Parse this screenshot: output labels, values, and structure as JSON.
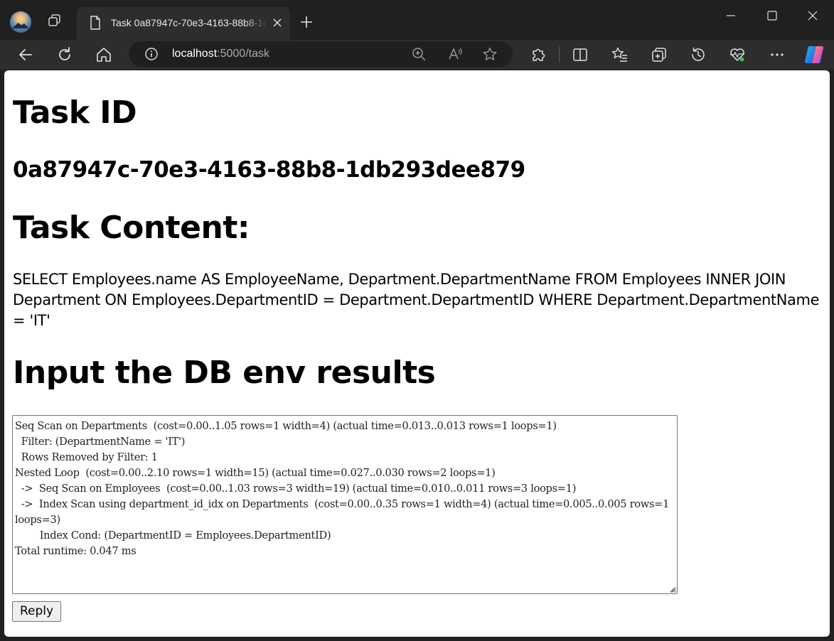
{
  "browser": {
    "tab": {
      "title": "Task 0a87947c-70e3-4163-88b8-1db293dee879"
    },
    "address": {
      "host": "localhost",
      "path": ":5000/task"
    }
  },
  "page": {
    "task_id_heading": "Task ID",
    "task_id_value": "0a87947c-70e3-4163-88b8-1db293dee879",
    "task_content_heading": "Task Content:",
    "task_content_text": "SELECT Employees.name AS EmployeeName, Department.DepartmentName FROM Employees INNER JOIN Department ON Employees.DepartmentID = Department.DepartmentID WHERE Department.DepartmentName = 'IT'",
    "input_heading": "Input the DB env results",
    "results_text": "Seq Scan on Departments  (cost=0.00..1.05 rows=1 width=4) (actual time=0.013..0.013 rows=1 loops=1)\n  Filter: (DepartmentName = 'IT')\n  Rows Removed by Filter: 1\nNested Loop  (cost=0.00..2.10 rows=1 width=15) (actual time=0.027..0.030 rows=2 loops=1)\n  ->  Seq Scan on Employees  (cost=0.00..1.03 rows=3 width=19) (actual time=0.010..0.011 rows=3 loops=1)\n  ->  Index Scan using department_id_idx on Departments  (cost=0.00..0.35 rows=1 width=4) (actual time=0.005..0.005 rows=1 loops=3)\n        Index Cond: (DepartmentID = Employees.DepartmentID)\nTotal runtime: 0.047 ms",
    "reply_label": "Reply"
  },
  "icons": {
    "profile": "profile-avatar-icon",
    "workspaces": "workspaces-icon",
    "tab_page": "page-icon",
    "tab_close": "close-icon",
    "new_tab": "plus-icon",
    "back": "back-arrow-icon",
    "refresh": "refresh-icon",
    "home": "home-icon",
    "site_info": "info-icon",
    "zoom": "zoom-in-icon",
    "read_aloud": "read-aloud-icon",
    "favorite": "star-icon",
    "extensions": "puzzle-icon",
    "split_screen": "split-screen-icon",
    "favorites": "favorites-list-icon",
    "collections": "collections-icon",
    "history": "history-icon",
    "performance": "heart-pulse-icon",
    "more": "more-icon",
    "copilot": "copilot-icon"
  }
}
